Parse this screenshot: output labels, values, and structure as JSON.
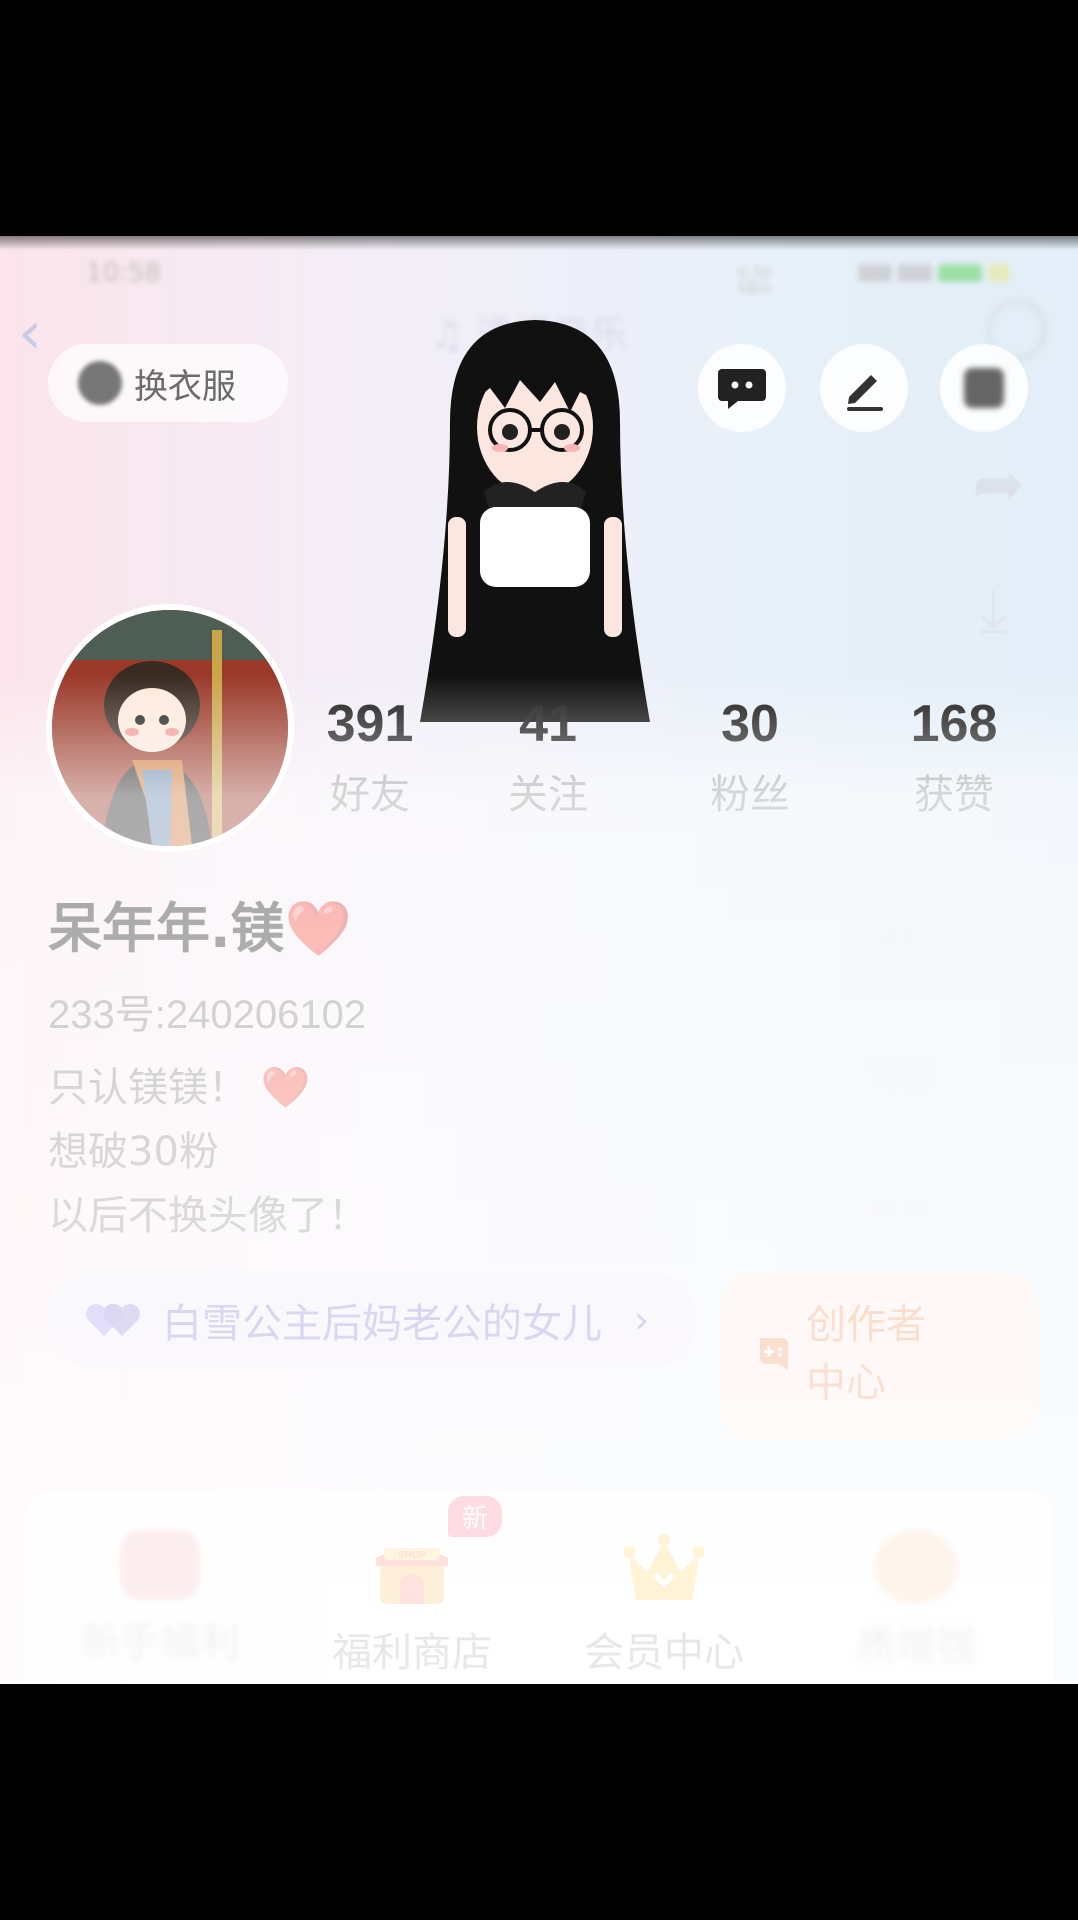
{
  "status_bar": {
    "time": "10:58",
    "net_speed_value": "0.50",
    "net_speed_unit": "KB/s"
  },
  "top_bar": {
    "music_title": "选择音乐",
    "dress_up_label": "换衣服"
  },
  "stats": [
    {
      "value": "391",
      "label": "好友"
    },
    {
      "value": "41",
      "label": "关注"
    },
    {
      "value": "30",
      "label": "粉丝"
    },
    {
      "value": "168",
      "label": "获赞"
    }
  ],
  "profile": {
    "nickname": "呆年年.镁❤️",
    "uid": "233号:240206102",
    "bio_line1": "只认镁镁！",
    "bio_heart": "❤️",
    "bio_line2": "想破30粉",
    "bio_line3": "以后不换头像了！",
    "relationship_tag": "白雪公主后妈老公的女儿"
  },
  "creator_center": {
    "label_line1": "创作者",
    "label_line2": "中心"
  },
  "side_menu": [
    "装扮",
    "动态",
    "相册",
    "标签"
  ],
  "quick_menu": [
    {
      "label": "新手福利"
    },
    {
      "label": "福利商店",
      "badge": "新",
      "icon_text": "SHOP"
    },
    {
      "label": "会员中心"
    },
    {
      "label": "质增强"
    }
  ],
  "colors": {
    "accent_purple": "#6f59c6",
    "creator_orange": "#f07b3c",
    "badge_red": "#ff4b6e"
  }
}
